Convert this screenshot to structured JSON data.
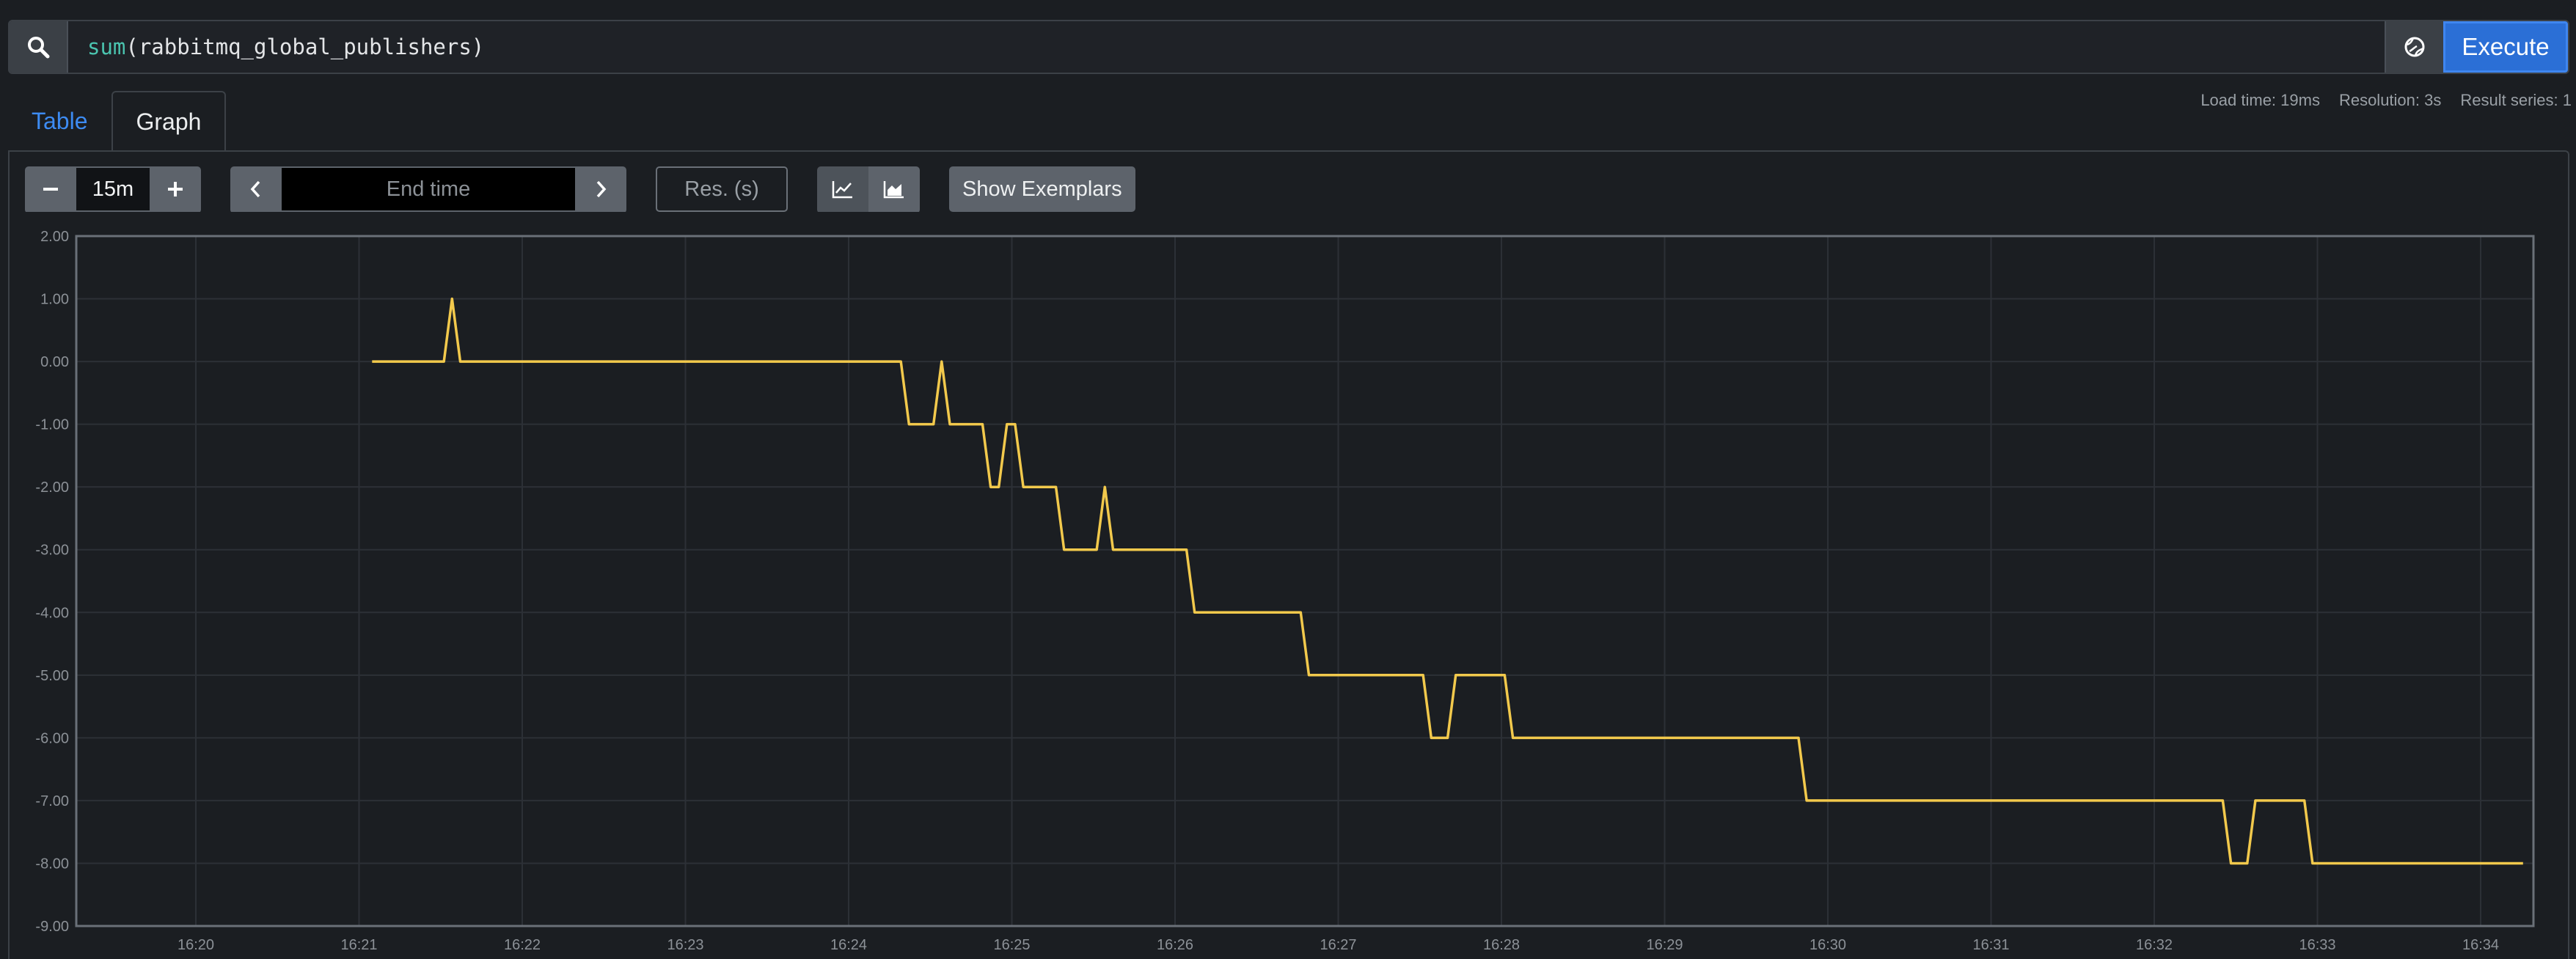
{
  "query": {
    "function": "sum",
    "argument": "(rabbitmq_global_publishers)",
    "execute_label": "Execute"
  },
  "tabs": {
    "table_label": "Table",
    "graph_label": "Graph"
  },
  "stats": {
    "load_time": "Load time: 19ms",
    "resolution": "Resolution: 3s",
    "result_series": "Result series: 1"
  },
  "controls": {
    "range": "15m",
    "end_time_placeholder": "End time",
    "resolution_placeholder": "Res. (s)",
    "show_exemplars_label": "Show Exemplars"
  },
  "colors": {
    "accent": "#2b6fd6",
    "series": "#f2c94c",
    "background": "#1b1e22"
  },
  "chart_data": {
    "type": "line",
    "y_ticks": [
      "2.00",
      "1.00",
      "0.00",
      "-1.00",
      "-2.00",
      "-3.00",
      "-4.00",
      "-5.00",
      "-6.00",
      "-7.00",
      "-8.00",
      "-9.00"
    ],
    "x_ticks": [
      "16:20",
      "16:21",
      "16:22",
      "16:23",
      "16:24",
      "16:25",
      "16:26",
      "16:27",
      "16:28",
      "16:29",
      "16:30",
      "16:31",
      "16:32",
      "16:33",
      "16:34"
    ],
    "ylim": [
      -9,
      2
    ],
    "xlim_minutes": [
      0,
      14.26
    ],
    "grid": true,
    "series": [
      {
        "points": [
          [
            1.08,
            0
          ],
          [
            1.52,
            0
          ],
          [
            1.57,
            1
          ],
          [
            1.62,
            0
          ],
          [
            4.32,
            0
          ],
          [
            4.37,
            -1
          ],
          [
            4.52,
            -1
          ],
          [
            4.57,
            0
          ],
          [
            4.62,
            -1
          ],
          [
            4.82,
            -1
          ],
          [
            4.87,
            -2
          ],
          [
            4.92,
            -2
          ],
          [
            4.97,
            -1
          ],
          [
            5.02,
            -1
          ],
          [
            5.07,
            -2
          ],
          [
            5.27,
            -2
          ],
          [
            5.32,
            -3
          ],
          [
            5.52,
            -3
          ],
          [
            5.57,
            -2
          ],
          [
            5.62,
            -3
          ],
          [
            6.07,
            -3
          ],
          [
            6.12,
            -4
          ],
          [
            6.77,
            -4
          ],
          [
            6.82,
            -5
          ],
          [
            7.52,
            -5
          ],
          [
            7.57,
            -6
          ],
          [
            7.67,
            -6
          ],
          [
            7.72,
            -5
          ],
          [
            8.02,
            -5
          ],
          [
            8.07,
            -6
          ],
          [
            9.82,
            -6
          ],
          [
            9.87,
            -7
          ],
          [
            12.42,
            -7
          ],
          [
            12.47,
            -8
          ],
          [
            12.57,
            -8
          ],
          [
            12.62,
            -7
          ],
          [
            12.92,
            -7
          ],
          [
            12.97,
            -8
          ],
          [
            14.26,
            -8
          ]
        ]
      }
    ]
  }
}
